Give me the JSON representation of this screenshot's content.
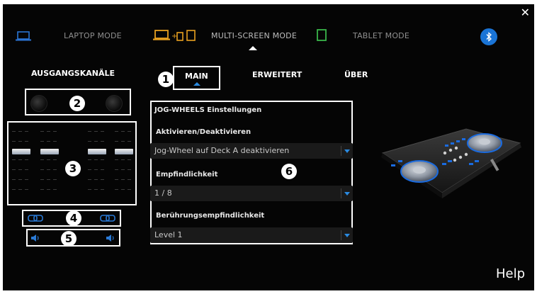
{
  "window": {
    "close_glyph": "✕"
  },
  "modes": [
    {
      "label": "LAPTOP MODE",
      "icon": "laptop-icon",
      "color": "#2a74d4"
    },
    {
      "label": "MULTI-SCREEN MODE",
      "icon": "multi-screen-icon",
      "color": "#e7a020"
    },
    {
      "label": "TABLET MODE",
      "icon": "tablet-icon",
      "color": "#3ab54a"
    }
  ],
  "bluetooth": {
    "icon": "bluetooth-icon",
    "color": "#1a74d6"
  },
  "left": {
    "title": "AUSGANGSKANÄLE"
  },
  "tabs": [
    {
      "label": "MAIN",
      "active": true
    },
    {
      "label": "ERWEITERT",
      "active": false
    },
    {
      "label": "ÜBER",
      "active": false
    }
  ],
  "jog": {
    "section_title": "JOG-WHEELS Einstellungen",
    "fields": [
      {
        "label": "Aktivieren/Deaktivieren",
        "value": "Jog-Wheel auf Deck A deaktivieren"
      },
      {
        "label": "Empfindlichkeit",
        "value": "1 / 8"
      },
      {
        "label": "Berührungsempfindlichkeit",
        "value": "Level 1"
      }
    ]
  },
  "markers": [
    "1",
    "2",
    "3",
    "4",
    "5",
    "6"
  ],
  "help": {
    "label": "Help"
  },
  "colors": {
    "accent": "#2a8ae0",
    "background": "#050505"
  }
}
